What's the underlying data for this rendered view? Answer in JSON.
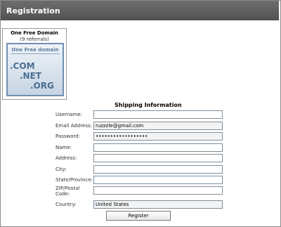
{
  "header": {
    "title": "Registration"
  },
  "promo": {
    "title": "One Free Domain",
    "subtitle": "(9 referrals)",
    "logo_text": "One Free domain",
    "ext_com": ".COM",
    "ext_net": ".NET",
    "ext_org": ".ORG"
  },
  "form": {
    "section_title": "Shipping Information",
    "fields": {
      "username": {
        "label": "Username:",
        "value": ""
      },
      "email": {
        "label": "Email Address:",
        "value": "ruzzzle@gmail.com"
      },
      "password": {
        "label": "Password:",
        "value": "••••••••••••••••••"
      },
      "name": {
        "label": "Name:",
        "value": ""
      },
      "address": {
        "label": "Address:",
        "value": ""
      },
      "city": {
        "label": "City:",
        "value": ""
      },
      "state": {
        "label": "State/Province:",
        "value": ""
      },
      "zip": {
        "label": "ZIP/Postal Code:",
        "value": ""
      },
      "country": {
        "label": "Country:",
        "value": "United States"
      }
    },
    "submit_label": "Register"
  }
}
